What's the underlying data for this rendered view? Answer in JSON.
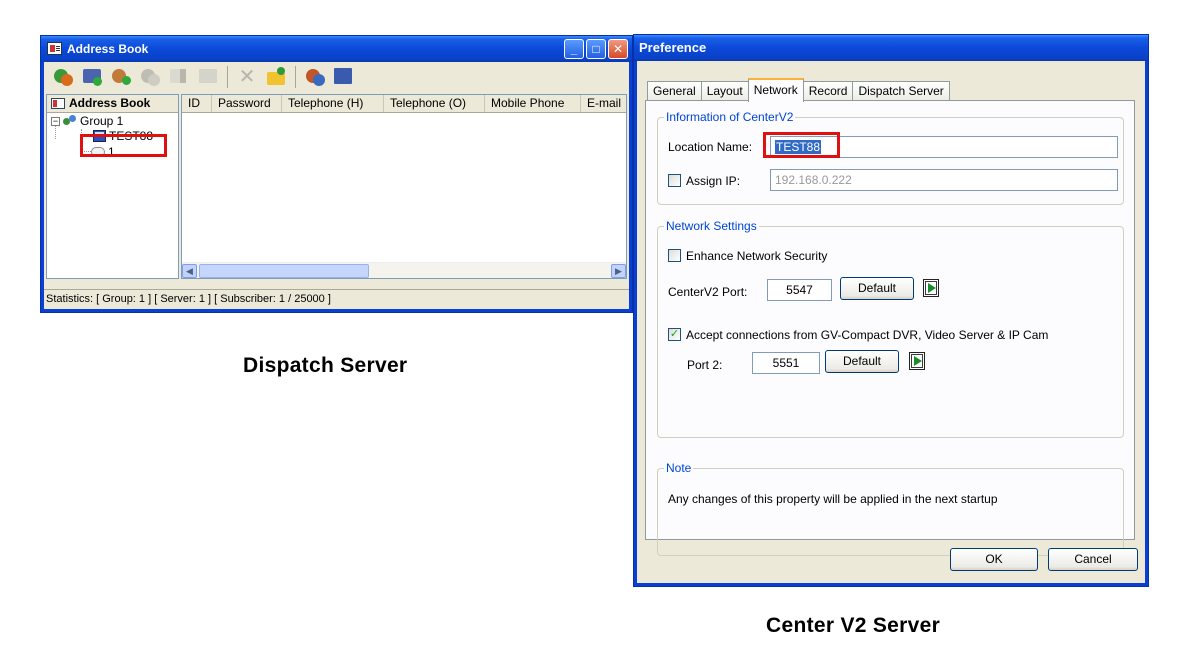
{
  "address_book": {
    "title": "Address Book",
    "tree": {
      "header": "Address Book",
      "group": "Group 1",
      "server": "TEST88",
      "subscriber": "1"
    },
    "columns": [
      "ID",
      "Password",
      "Telephone (H)",
      "Telephone (O)",
      "Mobile Phone",
      "E-mail"
    ],
    "status": "Statistics:  [ Group: 1 ]   [ Server: 1 ]   [ Subscriber: 1 / 25000 ]"
  },
  "preference": {
    "title": "Preference",
    "tabs": [
      "General",
      "Layout",
      "Network",
      "Record",
      "Dispatch Server"
    ],
    "active_tab": "Network",
    "info_group": {
      "legend": "Information of CenterV2",
      "location_label": "Location Name:",
      "location_value": "TEST88",
      "assign_ip_label": "Assign IP:",
      "assign_ip_checked": false,
      "ip_value": "192.168.0.222"
    },
    "network_group": {
      "legend": "Network Settings",
      "enhance_label": "Enhance Network Security",
      "enhance_checked": false,
      "port_label": "CenterV2 Port:",
      "port_value": "5547",
      "default_label": "Default",
      "accept_label": "Accept connections from GV-Compact DVR, Video Server & IP Cam",
      "accept_checked": true,
      "port2_label": "Port 2:",
      "port2_value": "5551",
      "default2_label": "Default"
    },
    "note_group": {
      "legend": "Note",
      "text": "Any changes of this property will be applied in the next startup"
    },
    "ok_label": "OK",
    "cancel_label": "Cancel"
  },
  "captions": {
    "left": "Dispatch Server",
    "right": "Center V2 Server"
  },
  "colors": {
    "title_bar": "#0a46d0",
    "highlight": "#e01010",
    "selection": "#316ac5",
    "group_legend": "#0046d5"
  }
}
